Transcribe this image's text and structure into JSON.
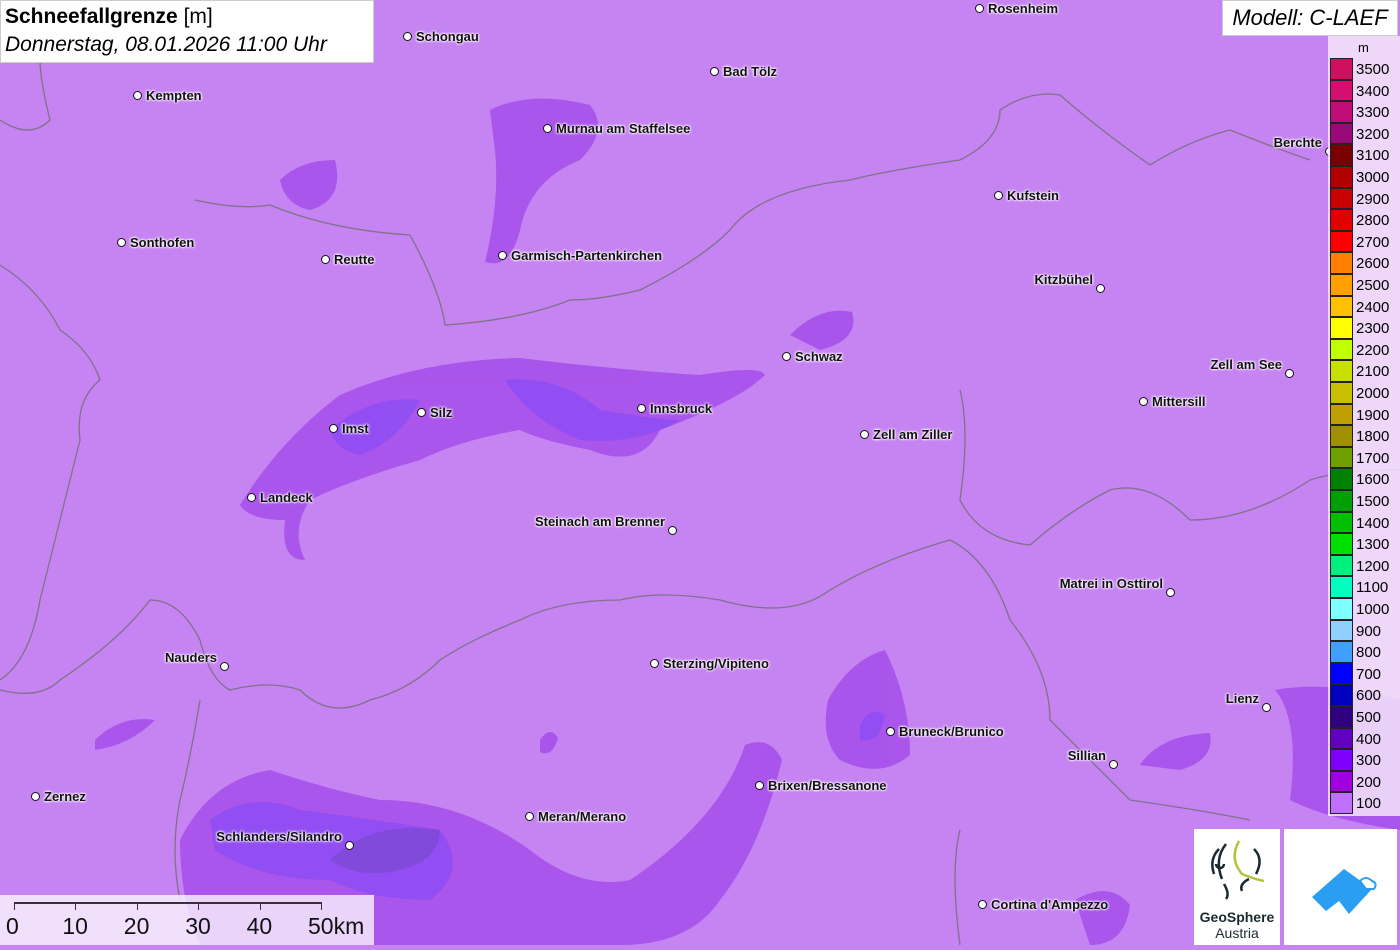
{
  "title": {
    "param": "Schneefallgrenze",
    "unit": "[m]",
    "datetime": "Donnerstag, 08.01.2026 11:00 Uhr"
  },
  "model": "Modell: C-LAEF",
  "cities": [
    "Rosenheim",
    "Schongau",
    "Kempten",
    "Bad Tölz",
    "Murnau am Staffelsee",
    "Berchte",
    "Kufstein",
    "Sonthofen",
    "Reutte",
    "Garmisch-Partenkirchen",
    "Kitzbühel",
    "Schwaz",
    "Zell am See",
    "Innsbruck",
    "Silz",
    "Imst",
    "Mittersill",
    "Zell am Ziller",
    "Landeck",
    "Steinach am Brenner",
    "Matrei in Osttirol",
    "Nauders",
    "Sterzing/Vipiteno",
    "Lienz",
    "Bruneck/Brunico",
    "Sillian",
    "Brixen/Bressanone",
    "Zernez",
    "Meran/Merano",
    "Schlanders/Silandro",
    "Cortina d'Ampezzo"
  ],
  "legend": {
    "unit": "m",
    "items": [
      {
        "label": "3500",
        "color": "#d0105f"
      },
      {
        "label": "3400",
        "color": "#d40f70"
      },
      {
        "label": "3300",
        "color": "#c00c78"
      },
      {
        "label": "3200",
        "color": "#980a78"
      },
      {
        "label": "3100",
        "color": "#780000"
      },
      {
        "label": "3000",
        "color": "#b00000"
      },
      {
        "label": "2900",
        "color": "#c80000"
      },
      {
        "label": "2800",
        "color": "#e00000"
      },
      {
        "label": "2700",
        "color": "#ff0000"
      },
      {
        "label": "2600",
        "color": "#ff8000"
      },
      {
        "label": "2500",
        "color": "#ffa000"
      },
      {
        "label": "2400",
        "color": "#ffc000"
      },
      {
        "label": "2300",
        "color": "#ffff00"
      },
      {
        "label": "2200",
        "color": "#c0ff00"
      },
      {
        "label": "2100",
        "color": "#c8e000"
      },
      {
        "label": "2000",
        "color": "#c8c000"
      },
      {
        "label": "1900",
        "color": "#c0a000"
      },
      {
        "label": "1800",
        "color": "#a09000"
      },
      {
        "label": "1700",
        "color": "#70a000"
      },
      {
        "label": "1600",
        "color": "#008000"
      },
      {
        "label": "1500",
        "color": "#00a000"
      },
      {
        "label": "1400",
        "color": "#00c000"
      },
      {
        "label": "1300",
        "color": "#00e000"
      },
      {
        "label": "1200",
        "color": "#00f080"
      },
      {
        "label": "1100",
        "color": "#00ffc0"
      },
      {
        "label": "1000",
        "color": "#80ffff"
      },
      {
        "label": "900",
        "color": "#90d0ff"
      },
      {
        "label": "800",
        "color": "#40a0ff"
      },
      {
        "label": "700",
        "color": "#0000ff"
      },
      {
        "label": "600",
        "color": "#0000c0"
      },
      {
        "label": "500",
        "color": "#300080"
      },
      {
        "label": "400",
        "color": "#6000c0"
      },
      {
        "label": "300",
        "color": "#8000ff"
      },
      {
        "label": "200",
        "color": "#a000e0"
      },
      {
        "label": "100",
        "color": "#c070ff"
      }
    ]
  },
  "scale": [
    "0",
    "10",
    "20",
    "30",
    "40",
    "50km"
  ],
  "logos": {
    "geosphere_line1": "GeoSphere",
    "geosphere_line2": "Austria"
  }
}
